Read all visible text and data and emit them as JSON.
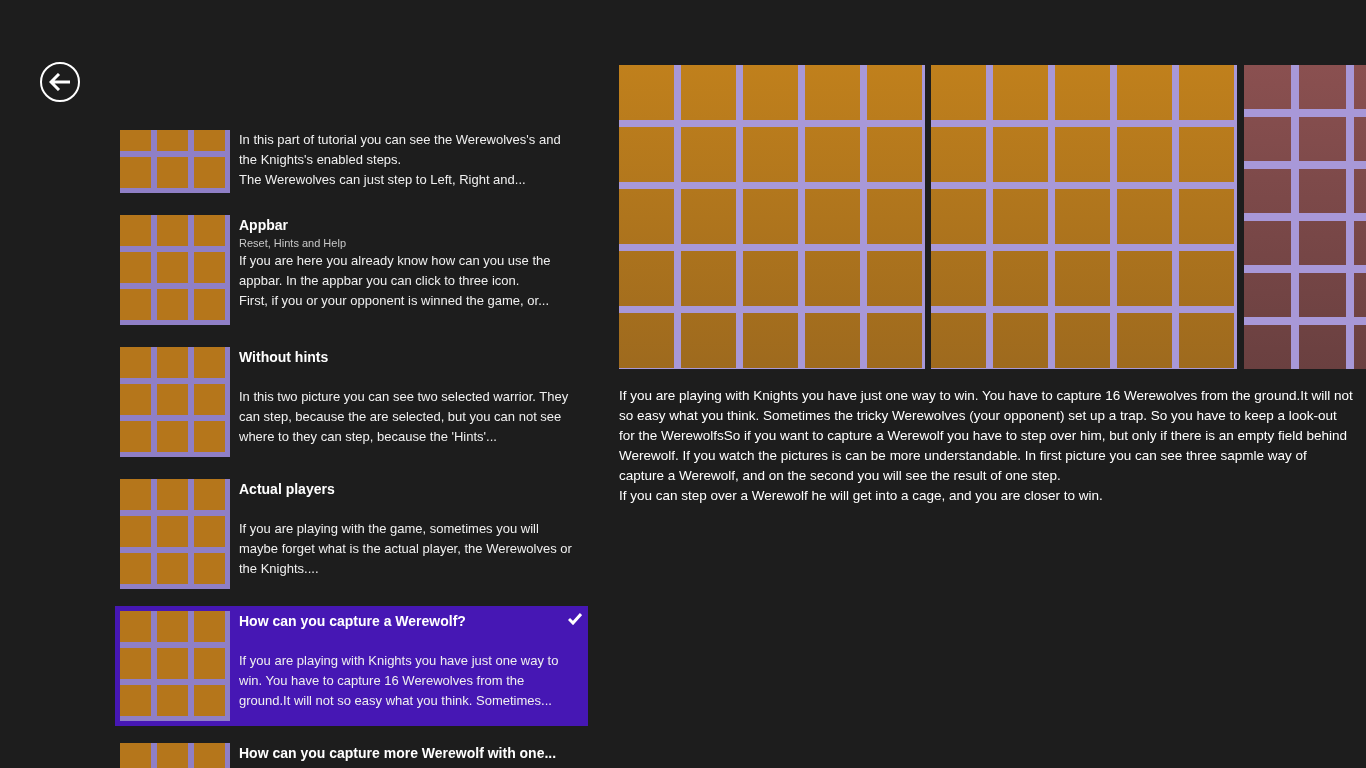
{
  "items": [
    {
      "body": "In this part of tutorial you can see the Werewolves's and the Knights's enabled steps.\nThe Werewolves can just step to Left, Right and...",
      "selected": false
    },
    {
      "title": "Appbar",
      "subtitle": "Reset, Hints and Help",
      "body": "If you are here you already know how can you use the appbar. In the appbar you can click to three icon.\nFirst, if you or your opponent is winned the game, or...",
      "selected": false
    },
    {
      "title": "Without hints",
      "body": "In this two picture you can see two selected warrior. They can step, because the are selected, but you can not see where to they can step, because the 'Hints'...",
      "selected": false
    },
    {
      "title": "Actual players",
      "body": "If you are playing with the game, sometimes you will maybe forget what is the actual player, the Werewolves or the Knights....",
      "selected": false
    },
    {
      "title": "How can you capture a Werewolf?",
      "body": "If you are playing with Knights you have just one way to win. You have to capture 16 Werewolves from the ground.It will not so easy what you think. Sometimes...",
      "selected": true
    },
    {
      "title": "How can you capture more Werewolf with one...",
      "selected": false
    }
  ],
  "detail": {
    "paragraphs": [
      "If you are playing with Knights you have just one way to win. You have to capture 16 Werewolves from the ground.It will not so easy what you think. Sometimes the tricky Werewolves (your opponent) set up a trap. So you have to keep a look-out for the WerewolfsSo if you want to capture a Werewolf you have to step over him, but only if there is an empty field behind Werewolf. If you watch the pictures is can be more understandable. In first picture you can see three sapmle way of capture a Werewolf, and on the second you will see the result of one step.",
      "If you can step over a Werewolf he will get into a cage, and you are closer to win."
    ]
  }
}
